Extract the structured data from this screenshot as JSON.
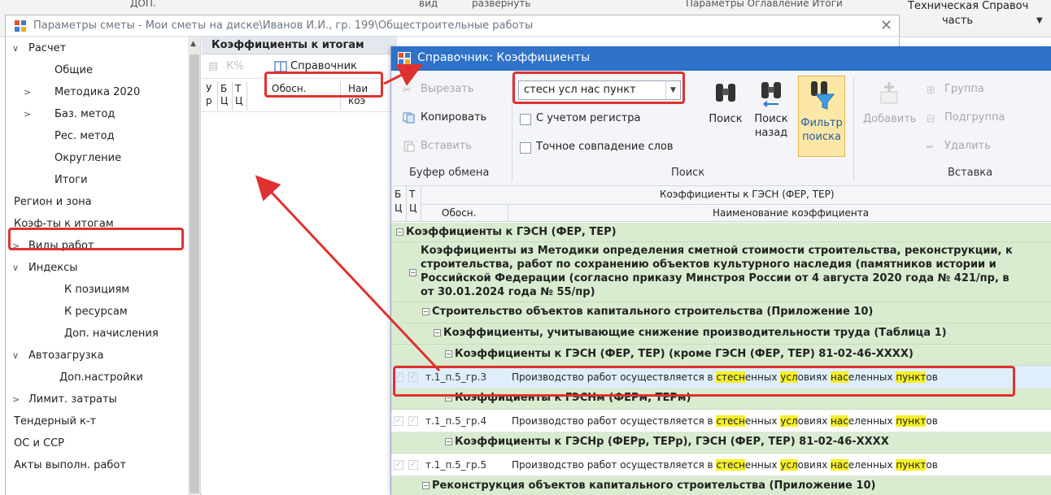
{
  "bg": {
    "tab1": "ДОП.",
    "tab2": "вид",
    "tab3": "развернуть",
    "tab4": "Параметры  Оглавление  Итоги",
    "tech_line1": "Техническая  Справоч",
    "tech_line2": "часть"
  },
  "main": {
    "title": "Параметры сметы - Мои сметы на диске\\Иванов И.И., гр. 199\\Общестроительные работы"
  },
  "sidebar": {
    "items": [
      {
        "label": "Расчет",
        "arrow": "∨"
      },
      {
        "label": "Общие",
        "arrow": ""
      },
      {
        "label": "Методика 2020",
        "arrow": ">"
      },
      {
        "label": "Баз. метод",
        "arrow": ">"
      },
      {
        "label": "Рес. метод",
        "arrow": ""
      },
      {
        "label": "Округление",
        "arrow": ""
      },
      {
        "label": "Итоги",
        "arrow": ""
      },
      {
        "label": "Регион и зона",
        "arrow": ""
      },
      {
        "label": "Коэф-ты к итогам",
        "arrow": ""
      },
      {
        "label": "Виды работ",
        "arrow": ">"
      },
      {
        "label": "Индексы",
        "arrow": "∨"
      },
      {
        "label": "К позициям",
        "arrow": ""
      },
      {
        "label": "К ресурсам",
        "arrow": ""
      },
      {
        "label": "Доп. начисления",
        "arrow": ""
      },
      {
        "label": "Автозагрузка",
        "arrow": "∨"
      },
      {
        "label": "Доп.настройки",
        "arrow": ""
      },
      {
        "label": "Лимит. затраты",
        "arrow": ">"
      },
      {
        "label": "Тендерный к-т",
        "arrow": ""
      },
      {
        "label": "ОС и ССР",
        "arrow": ""
      },
      {
        "label": "Акты выполн. работ",
        "arrow": ""
      }
    ]
  },
  "mid": {
    "header": "Коэффициенты к итогам",
    "ref_button": "Справочник",
    "cols": {
      "u": "У",
      "p": "р",
      "b": "Б",
      "c1": "Ц",
      "t": "Т",
      "c2": "Ц",
      "obosn": "Обосн.",
      "name1": "Наи",
      "name2": "коэ"
    }
  },
  "dialog": {
    "title": "Справочник: Коэффициенты",
    "ribbon": {
      "cut": "Вырезать",
      "copy": "Копировать",
      "paste": "Вставить",
      "clipboard_group": "Буфер обмена",
      "search_value": "стесн усл нас пункт",
      "match_case": "С учетом регистра",
      "whole_words": "Точное совпадение слов",
      "search_btn": "Поиск",
      "search_back_line1": "Поиск",
      "search_back_line2": "назад",
      "filter_line1": "Фильтр",
      "filter_line2": "поиска",
      "search_group": "Поиск",
      "add": "Добавить",
      "group": "Группа",
      "subgroup": "Подгруппа",
      "delete": "Удалить",
      "insert_group": "Вставка"
    },
    "grid_header": {
      "b": "Б",
      "c1": "Ц",
      "t": "Т",
      "c2": "Ц",
      "band": "Коэффициенты к ГЭСН (ФЕР, ТЕР)",
      "obosn": "Обосн.",
      "name": "Наименование коэффициента"
    },
    "rows": {
      "g1": "Коэффициенты к ГЭСН (ФЕР, ТЕР)",
      "g2_l1": "Коэффициенты из Методики определения сметной стоимости строительства, реконструкции, к",
      "g2_l2": "строительства, работ по сохранению объектов культурного наследия (памятников истории и",
      "g2_l3": "Российской Федерации (согласно приказу Минстроя России от 4 августа 2020 года № 421/пр, в",
      "g2_l4": "от 30.01.2024 года № 55/пр)",
      "g3": "Строительство объектов капитального строительства (Приложение 10)",
      "g4": "Коэффициенты, учитывающие снижение производительности труда (Таблица 1)",
      "g5": "Коэффициенты к ГЭСН (ФЕР, ТЕР) (кроме ГЭСН (ФЕР, ТЕР) 81-02-46-XXXX)",
      "r1_code": "т.1_п.5_гр.3",
      "g6": "Коэффициенты к ГЭСНм (ФЕРм, ТЕРм)",
      "r2_code": "т.1_п.5_гр.4",
      "g7": "Коэффициенты к ГЭСНр (ФЕРр, ТЕРр), ГЭСН (ФЕР, ТЕР) 81-02-46-XXXX",
      "r3_code": "т.1_п.5_гр.5",
      "g8": "Реконструкция объектов капитального строительства (Приложение 10)",
      "name_parts": {
        "p1": "Производство работ осуществляется в ",
        "h1": "стесн",
        "p2": "енных ",
        "h2": "усл",
        "p3": "овиях ",
        "h3": "нас",
        "p4": "еленных ",
        "h4": "пункт",
        "p5": "ов"
      }
    }
  },
  "colors": {
    "highlight_red": "#e03131",
    "dialog_title_blue": "#2e72c9",
    "group_green": "#d9ecd0",
    "search_yellow": "#f7ef2a"
  }
}
